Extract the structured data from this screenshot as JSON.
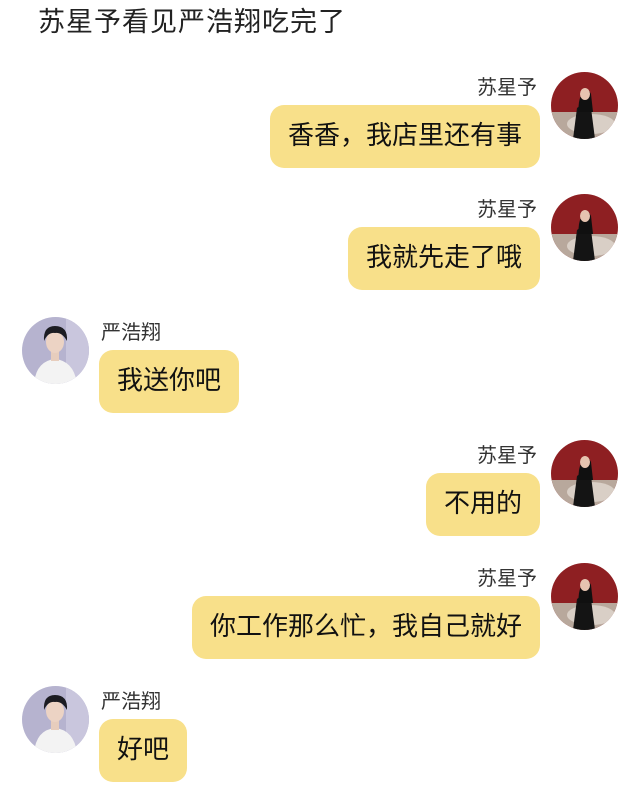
{
  "caption": "苏星予看见严浩翔吃完了",
  "colors": {
    "bubble": "#f8e08a",
    "background": "#ffffff"
  },
  "messages": [
    {
      "sender": "苏星予",
      "side": "right",
      "text": "香香，我店里还有事",
      "avatar": "woman-red-background-avatar"
    },
    {
      "sender": "苏星予",
      "side": "right",
      "text": "我就先走了哦",
      "avatar": "woman-red-background-avatar"
    },
    {
      "sender": "严浩翔",
      "side": "left",
      "text": "我送你吧",
      "avatar": "man-white-shirt-avatar"
    },
    {
      "sender": "苏星予",
      "side": "right",
      "text": "不用的",
      "avatar": "woman-red-background-avatar"
    },
    {
      "sender": "苏星予",
      "side": "right",
      "text": "你工作那么忙，我自己就好",
      "avatar": "woman-red-background-avatar"
    },
    {
      "sender": "严浩翔",
      "side": "left",
      "text": "好吧",
      "avatar": "man-white-shirt-avatar"
    }
  ]
}
